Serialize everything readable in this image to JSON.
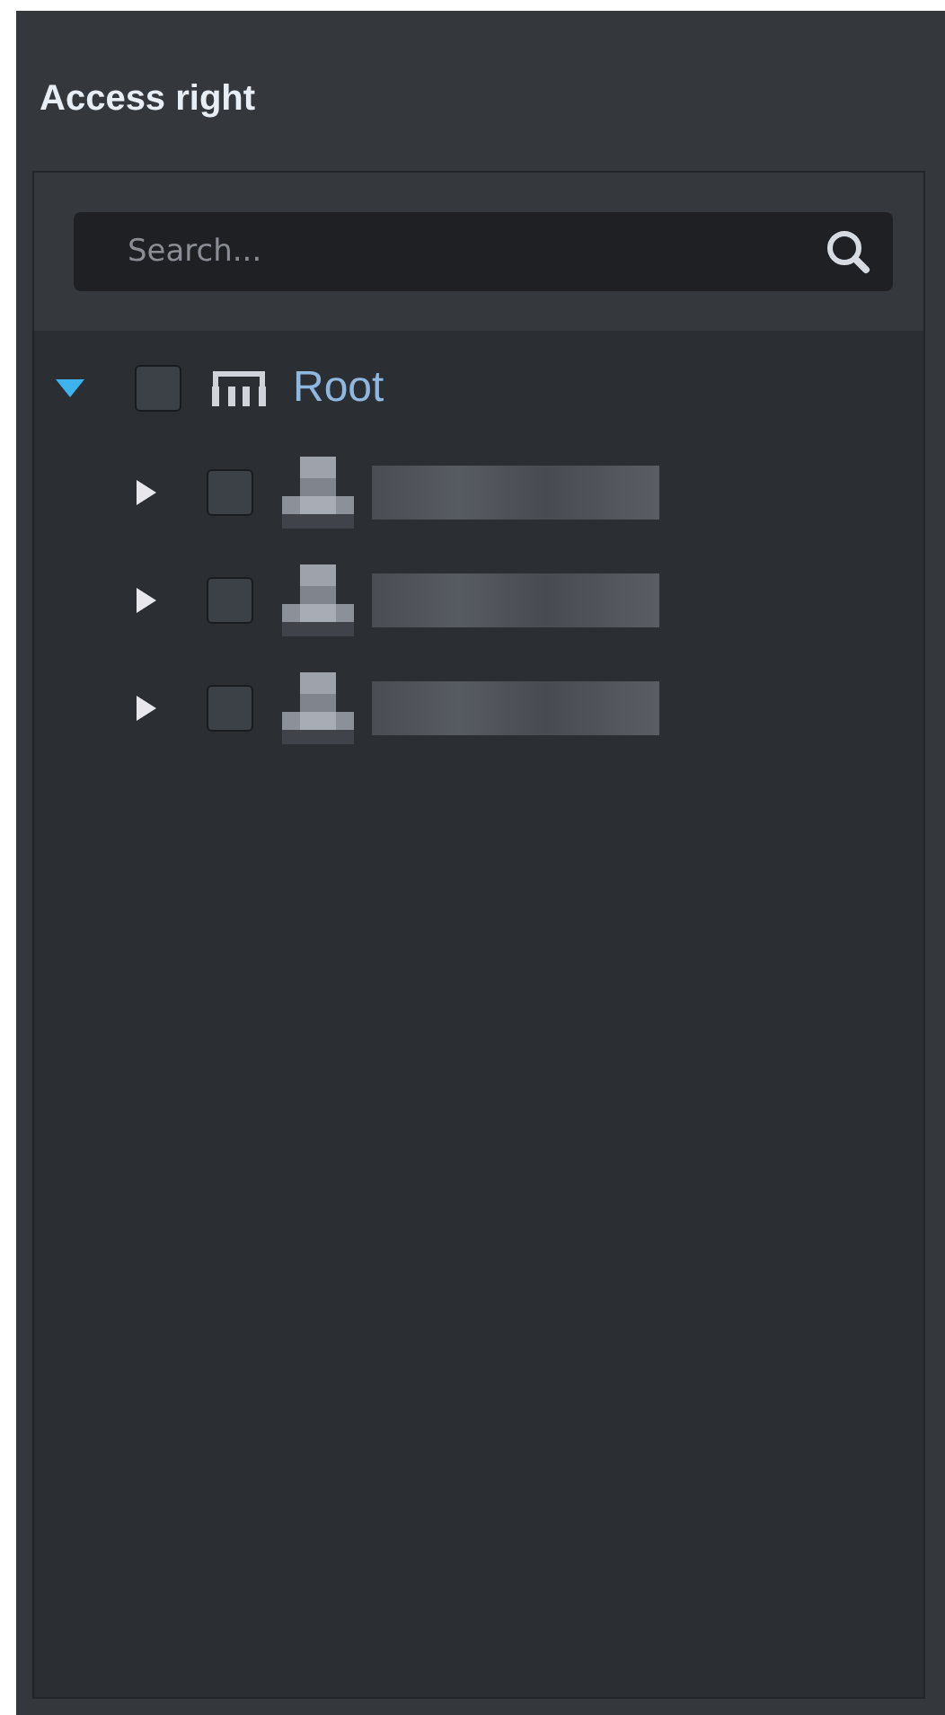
{
  "panel": {
    "title": "Access right"
  },
  "search": {
    "placeholder": "Search..."
  },
  "tree": [
    {
      "kind": "root",
      "label": "Root",
      "expanded": true,
      "checked": false,
      "children": [
        {
          "kind": "user",
          "expanded": false,
          "checked": false
        },
        {
          "kind": "user",
          "expanded": false,
          "checked": false
        },
        {
          "kind": "user",
          "expanded": false,
          "checked": false
        }
      ]
    }
  ]
}
